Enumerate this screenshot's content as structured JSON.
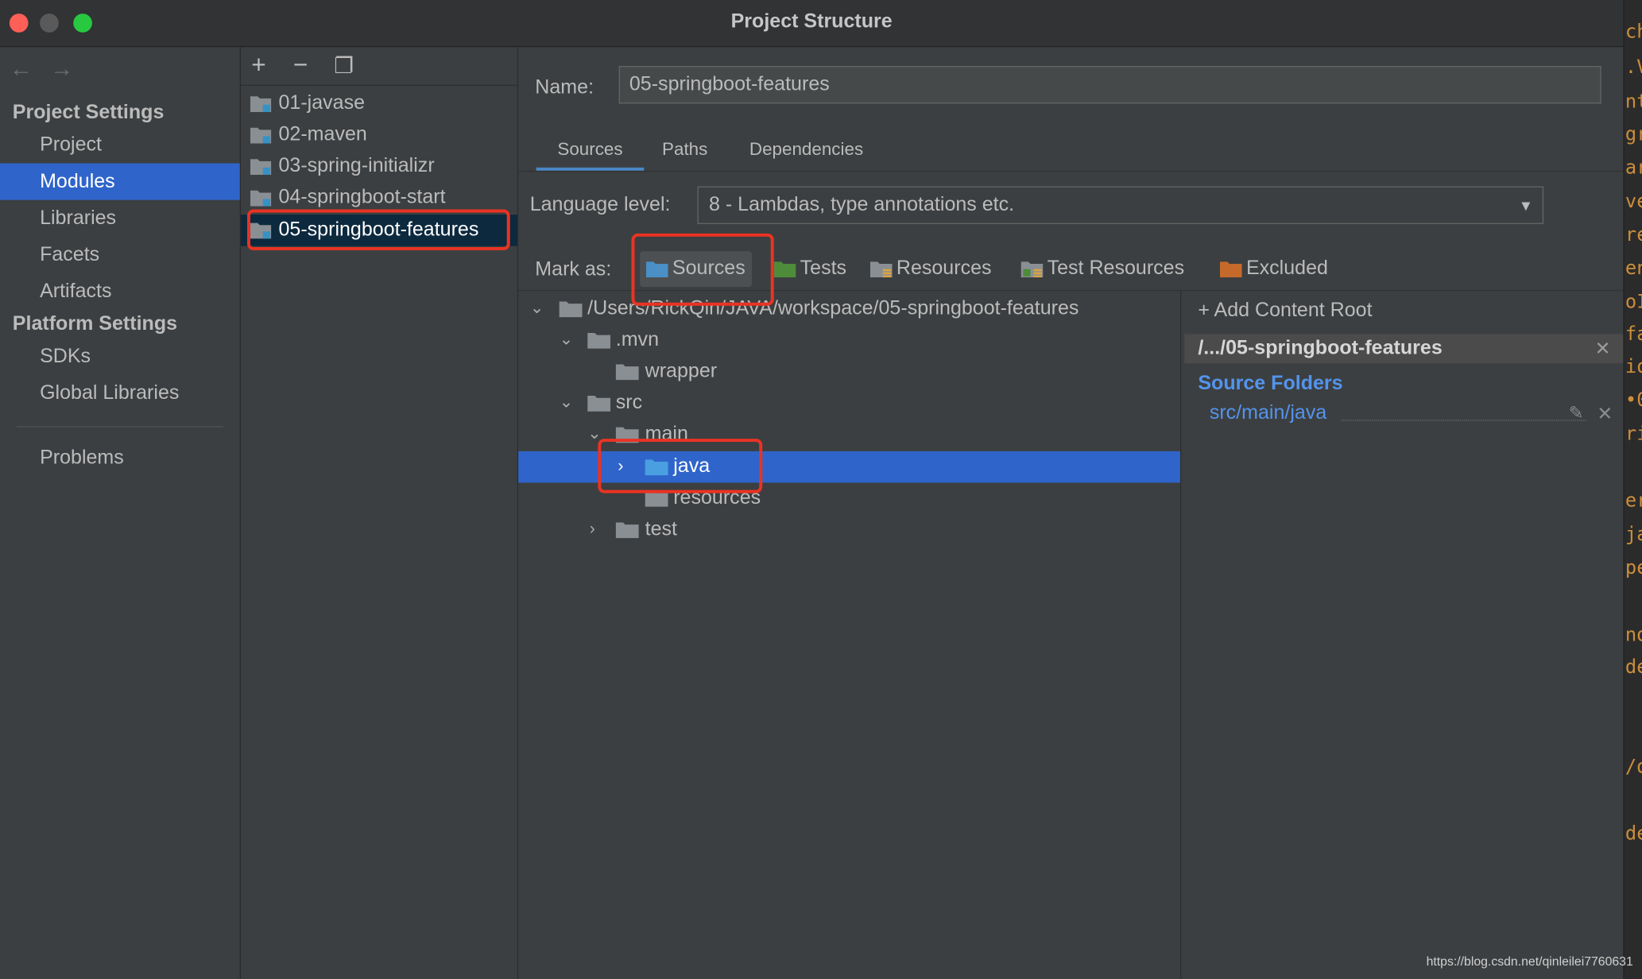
{
  "window": {
    "title": "Project Structure"
  },
  "nav": {
    "back_icon": "←",
    "forward_icon": "→"
  },
  "sidebar": {
    "project_settings": "Project Settings",
    "project_items": [
      "Project",
      "Modules",
      "Libraries",
      "Facets",
      "Artifacts"
    ],
    "platform_settings": "Platform Settings",
    "platform_items": [
      "SDKs",
      "Global Libraries"
    ],
    "problems": "Problems",
    "selected": "Modules"
  },
  "modules": {
    "toolbar": {
      "add": "+",
      "remove": "−",
      "copy": "❐"
    },
    "items": [
      "01-javase",
      "02-maven",
      "03-spring-initializr",
      "04-springboot-start",
      "05-springboot-features"
    ],
    "selected": "05-springboot-features"
  },
  "detail": {
    "name_label": "Name:",
    "name_value": "05-springboot-features",
    "tabs": [
      "Sources",
      "Paths",
      "Dependencies"
    ],
    "active_tab": "Sources",
    "language_label": "Language level:",
    "language_value": "8 - Lambdas, type annotations etc.",
    "mark_as_label": "Mark as:",
    "mark_as": [
      "Sources",
      "Tests",
      "Resources",
      "Test Resources",
      "Excluded"
    ],
    "mark_colors": {
      "sources": "#4a8fc6",
      "tests": "#4e8c3b",
      "resources": "#8a8f94",
      "excluded": "#c66a2b"
    }
  },
  "tree": {
    "root": "/Users/RickQin/JAVA/workspace/05-springboot-features",
    "mvn": ".mvn",
    "wrapper": "wrapper",
    "src": "src",
    "main": "main",
    "java": "java",
    "resources": "resources",
    "test": "test"
  },
  "content_roots": {
    "add_label": "Add Content Root",
    "root_short": "/.../05-springboot-features",
    "source_folders_header": "Source Folders",
    "source_folders": [
      "src/main/java"
    ]
  },
  "editor_peek": [
    "ch",
    ".V",
    "nt",
    "gr",
    "ar",
    "ve",
    "re",
    "en",
    "oI",
    "fa",
    "io",
    "•0",
    "ri",
    "er",
    "ja",
    "pe",
    "nd",
    "de",
    "/d",
    "de"
  ],
  "watermark": "https://blog.csdn.net/qinleilei7760631",
  "highlight_color": "#ea3323"
}
